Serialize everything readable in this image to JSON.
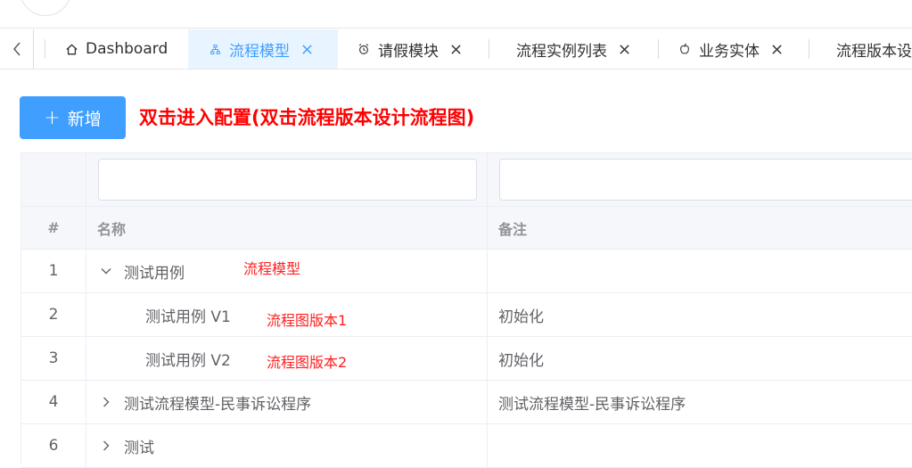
{
  "tabs": [
    {
      "label": "Dashboard",
      "icon": "home-icon",
      "closable": false,
      "active": false
    },
    {
      "label": "流程模型",
      "icon": "sitemap-icon",
      "closable": true,
      "active": true
    },
    {
      "label": "请假模块",
      "icon": "alarm-icon",
      "closable": true,
      "active": false
    },
    {
      "label": "流程实例列表",
      "icon": "",
      "closable": true,
      "active": false
    },
    {
      "label": "业务实体",
      "icon": "apple-icon",
      "closable": true,
      "active": false
    },
    {
      "label": "流程版本设",
      "icon": "",
      "closable": false,
      "active": false
    }
  ],
  "toolbar": {
    "add_label": "新增",
    "hint": "双击进入配置(双击流程版本设计流程图)"
  },
  "table": {
    "headers": {
      "index": "#",
      "name": "名称",
      "note": "备注"
    },
    "rows": [
      {
        "index": "1",
        "name": "测试用例",
        "note": "",
        "expander": "expanded",
        "level": 0
      },
      {
        "index": "2",
        "name": "测试用例 V1",
        "note": "初始化",
        "expander": "none",
        "level": 1
      },
      {
        "index": "3",
        "name": "测试用例 V2",
        "note": "初始化",
        "expander": "none",
        "level": 1
      },
      {
        "index": "4",
        "name": "测试流程模型-民事诉讼程序",
        "note": "测试流程模型-民事诉讼程序",
        "expander": "collapsed",
        "level": 0
      },
      {
        "index": "6",
        "name": "测试",
        "note": "",
        "expander": "collapsed",
        "level": 0
      }
    ]
  },
  "annotations": {
    "model": "流程模型",
    "version1": "流程图版本1",
    "version2": "流程图版本2"
  },
  "colors": {
    "primary": "#409eff",
    "active_tab_bg": "#e8f4ff",
    "annotation_red": "#ff0000"
  }
}
